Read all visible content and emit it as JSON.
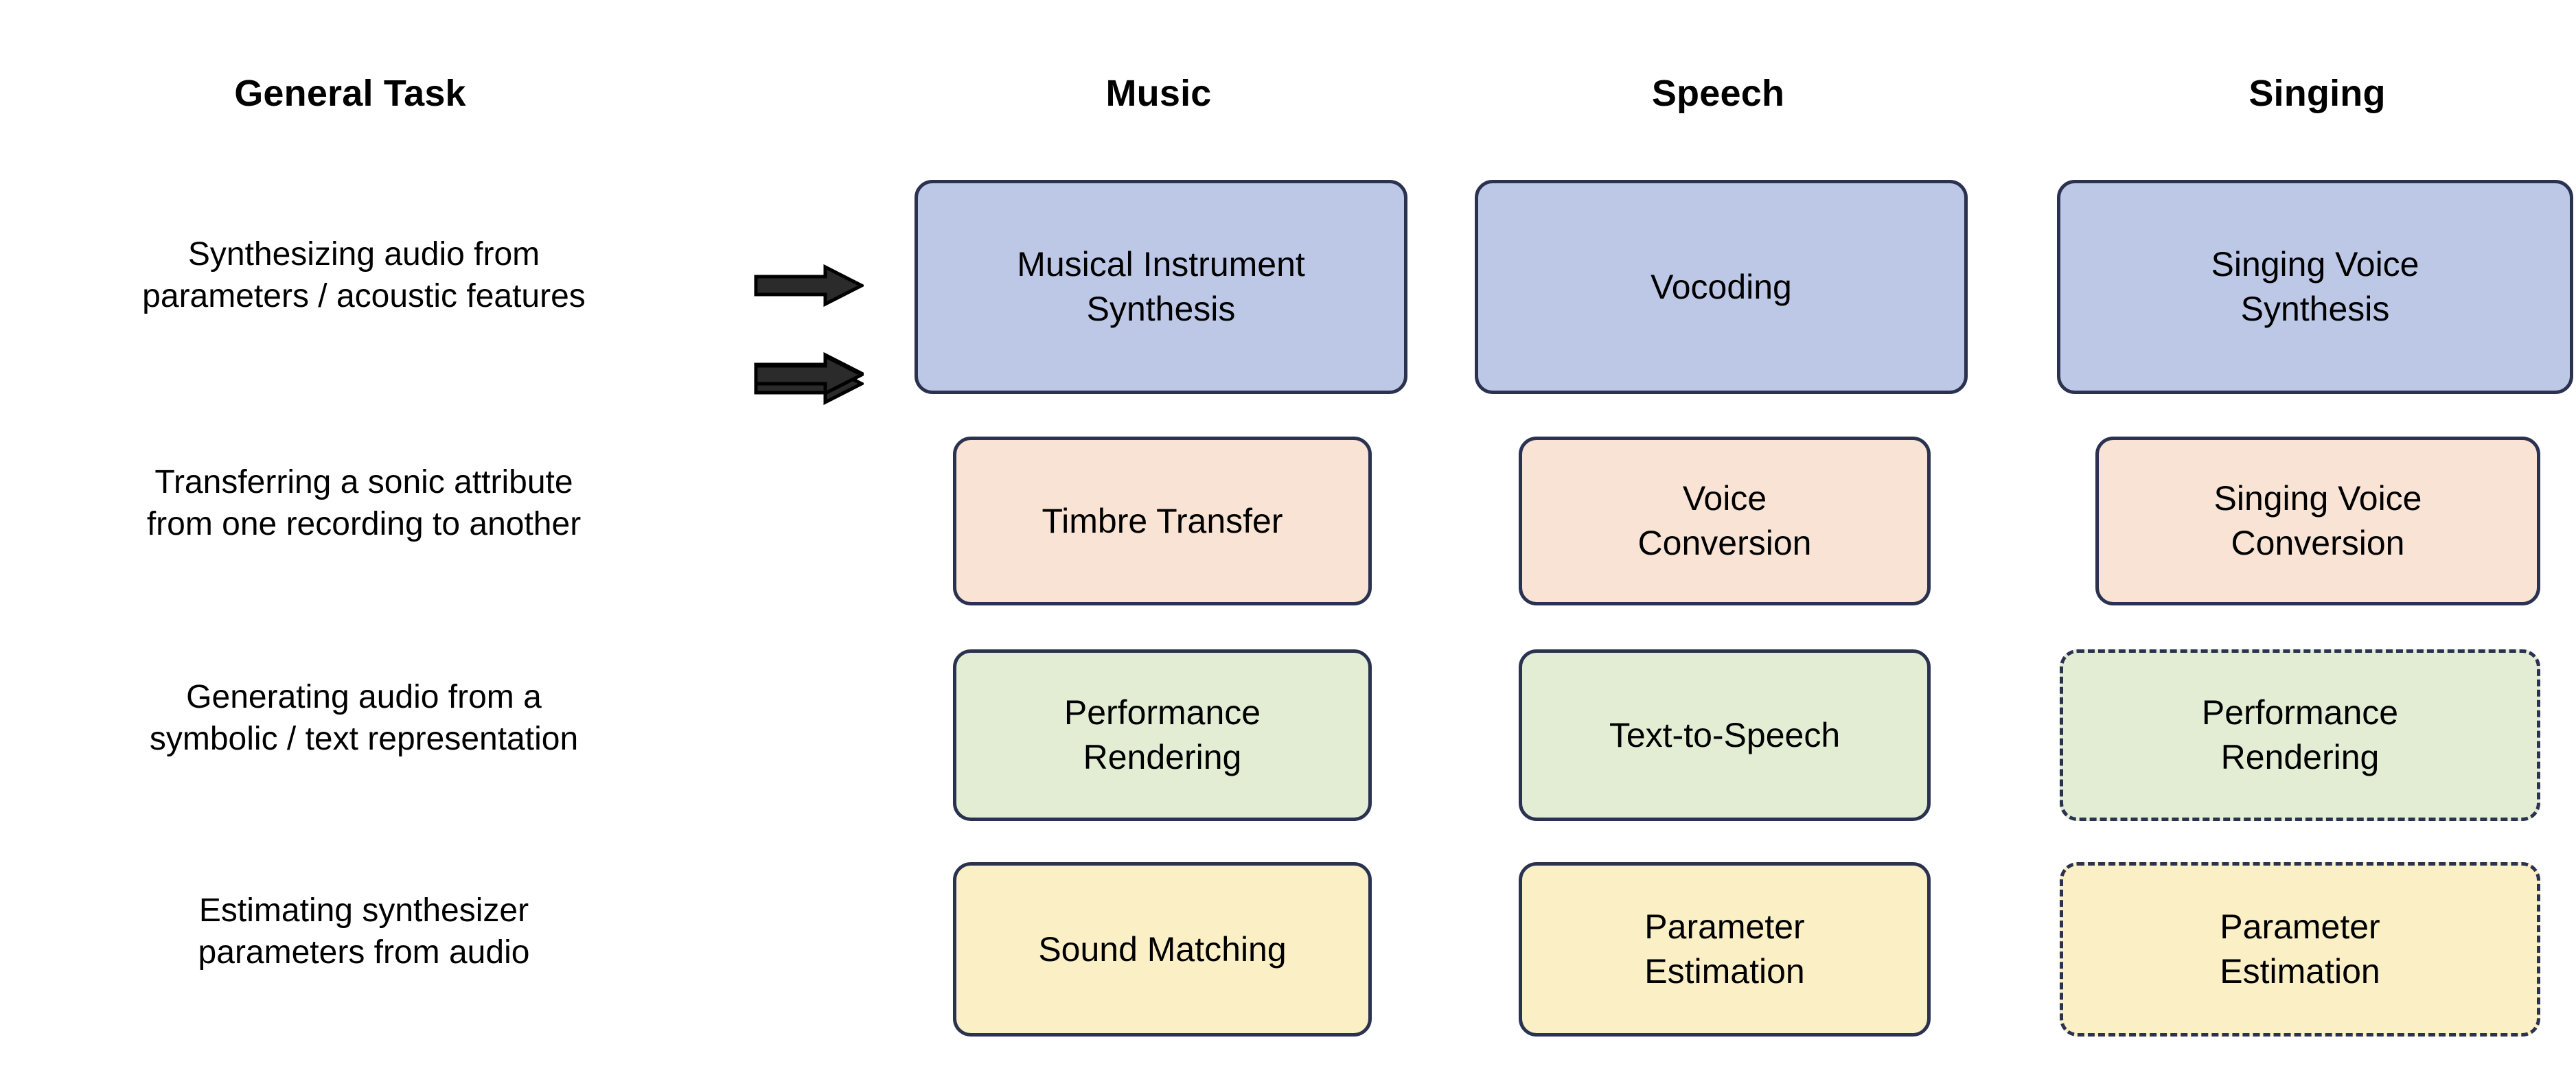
{
  "headers": {
    "general": "General Task",
    "music": "Music",
    "speech": "Speech",
    "singing": "Singing"
  },
  "arrow_icon_name": "right-arrow-icon",
  "colors": {
    "border": "#2A3250",
    "arrow_fill": "#2B2B2B",
    "arrow_stroke": "#000000",
    "row_synthesis": "#BCC8E6",
    "row_transfer": "#F8E3D4",
    "row_symbolic": "#E2EDD4",
    "row_parameter": "#FAEFC5",
    "background": "#FFFFFF"
  },
  "rows": [
    {
      "task_line1": "Synthesizing audio from",
      "task_line2": "parameters / acoustic features",
      "music_line1": "Musical Instrument",
      "music_line2": "Synthesis",
      "speech_line1": "Vocoding",
      "speech_line2": "",
      "singing_line1": "Singing Voice",
      "singing_line2": "Synthesis"
    },
    {
      "task_line1": "Transferring a sonic attribute",
      "task_line2": "from one recording to another",
      "music_line1": "Timbre Transfer",
      "music_line2": "",
      "speech_line1": "Voice",
      "speech_line2": "Conversion",
      "singing_line1": "Singing Voice",
      "singing_line2": "Conversion"
    },
    {
      "task_line1": "Generating audio from a",
      "task_line2": "symbolic / text representation",
      "music_line1": "Performance",
      "music_line2": "Rendering",
      "speech_line1": "Text-to-Speech",
      "speech_line2": "",
      "singing_line1": "Performance",
      "singing_line2": "Rendering"
    },
    {
      "task_line1": "Estimating synthesizer",
      "task_line2": "parameters from audio",
      "music_line1": "Sound Matching",
      "music_line2": "",
      "speech_line1": "Parameter",
      "speech_line2": "Estimation",
      "singing_line1": "Parameter",
      "singing_line2": "Estimation"
    }
  ]
}
